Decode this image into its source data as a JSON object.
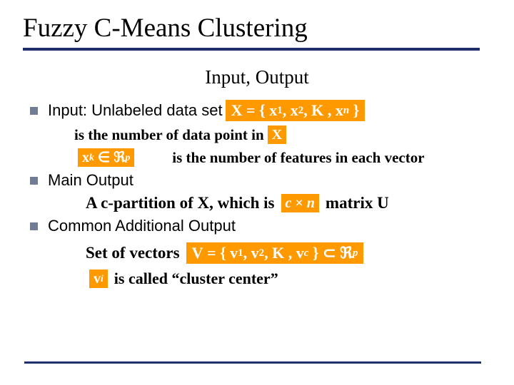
{
  "title": "Fuzzy C-Means Clustering",
  "subtitle": "Input, Output",
  "items": [
    {
      "label": "Input: Unlabeled data set"
    },
    {
      "label": "Main Output"
    },
    {
      "label": "Common Additional Output"
    }
  ],
  "input": {
    "set_expr": "X = { x₁, x₂, K , xₙ }",
    "n_desc_before": "",
    "n_desc_after": "is the number of data point in",
    "x_symbol": "X",
    "xk_expr": "xₖ ∈ ℜᵖ",
    "p_desc": "is the number of features in each vector"
  },
  "partition": {
    "before": "A c-partition of X, which is",
    "size_expr": "c × n",
    "after": "matrix U"
  },
  "vectors": {
    "label": "Set of vectors",
    "V_expr": "V = { v₁, v₂, K , v_c } ⊂ ℜᵖ",
    "vi_symbol": "vᵢ",
    "vi_desc": "is called “cluster center”"
  }
}
